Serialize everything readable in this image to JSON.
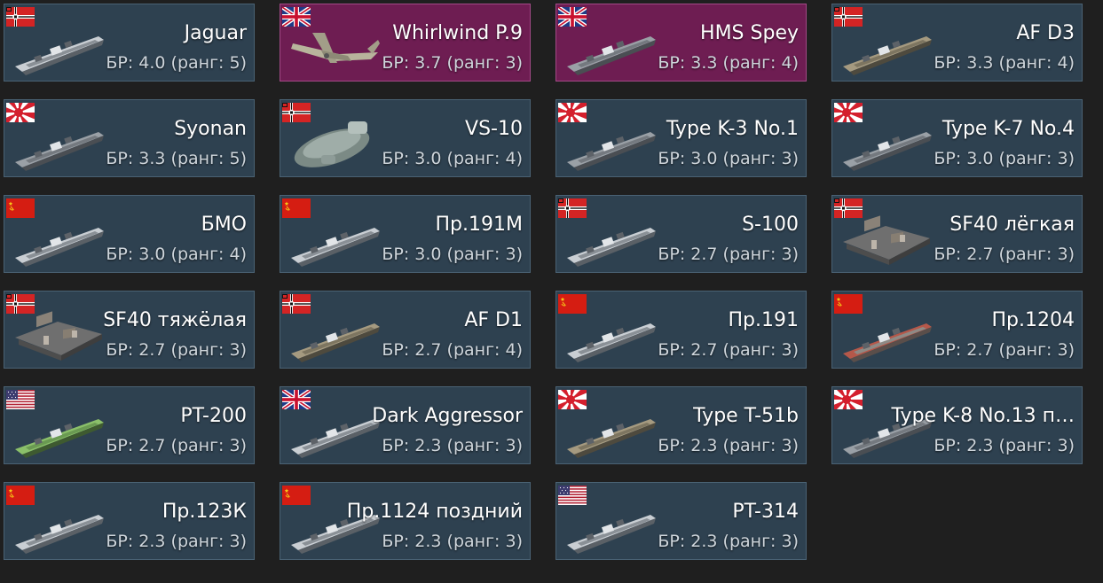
{
  "vehicles": [
    {
      "name": "Jaguar",
      "br": "БР: 4.0 (ранг: 5)",
      "nation": "germany",
      "premium": false,
      "type": "boat"
    },
    {
      "name": "Whirlwind P.9",
      "br": "БР: 3.7 (ранг: 3)",
      "nation": "uk",
      "premium": true,
      "type": "plane"
    },
    {
      "name": "HMS Spey",
      "br": "БР: 3.3 (ранг: 4)",
      "nation": "uk",
      "premium": true,
      "type": "ship"
    },
    {
      "name": "AF D3",
      "br": "БР: 3.3 (ранг: 4)",
      "nation": "germany",
      "premium": false,
      "type": "barge"
    },
    {
      "name": "Syonan",
      "br": "БР: 3.3 (ранг: 5)",
      "nation": "japan",
      "premium": false,
      "type": "ship"
    },
    {
      "name": "VS-10",
      "br": "БР: 3.0 (ранг: 4)",
      "nation": "germany",
      "premium": false,
      "type": "hover"
    },
    {
      "name": "Type K-3 No.1",
      "br": "БР: 3.0 (ранг: 3)",
      "nation": "japan",
      "premium": false,
      "type": "ship"
    },
    {
      "name": "Type K-7 No.4",
      "br": "БР: 3.0 (ранг: 3)",
      "nation": "japan",
      "premium": false,
      "type": "ship"
    },
    {
      "name": "БМО",
      "br": "БР: 3.0 (ранг: 4)",
      "nation": "ussr",
      "premium": false,
      "type": "boat"
    },
    {
      "name": "Пр.191М",
      "br": "БР: 3.0 (ранг: 3)",
      "nation": "ussr",
      "premium": false,
      "type": "boat"
    },
    {
      "name": "S-100",
      "br": "БР: 2.7 (ранг: 3)",
      "nation": "germany",
      "premium": false,
      "type": "boat"
    },
    {
      "name": "SF40 лёгкая",
      "br": "БР: 2.7 (ранг: 3)",
      "nation": "germany",
      "premium": false,
      "type": "ferry"
    },
    {
      "name": "SF40 тяжёлая",
      "br": "БР: 2.7 (ранг: 3)",
      "nation": "germany",
      "premium": false,
      "type": "ferry"
    },
    {
      "name": "AF D1",
      "br": "БР: 2.7 (ранг: 4)",
      "nation": "germany",
      "premium": false,
      "type": "barge"
    },
    {
      "name": "Пр.191",
      "br": "БР: 2.7 (ранг: 3)",
      "nation": "ussr",
      "premium": false,
      "type": "boat"
    },
    {
      "name": "Пр.1204",
      "br": "БР: 2.7 (ранг: 3)",
      "nation": "ussr",
      "premium": false,
      "type": "boat-red"
    },
    {
      "name": "PT-200",
      "br": "БР: 2.7 (ранг: 3)",
      "nation": "usa",
      "premium": false,
      "type": "boat-green"
    },
    {
      "name": "Dark Aggressor",
      "br": "БР: 2.3 (ранг: 3)",
      "nation": "uk",
      "premium": false,
      "type": "boat"
    },
    {
      "name": "Type T-51b",
      "br": "БР: 2.3 (ранг: 3)",
      "nation": "japan",
      "premium": false,
      "type": "barge"
    },
    {
      "name": "Type K-8 No.13 п…",
      "br": "БР: 2.3 (ранг: 3)",
      "nation": "japan",
      "premium": false,
      "type": "ship"
    },
    {
      "name": "Пр.123К",
      "br": "БР: 2.3 (ранг: 3)",
      "nation": "ussr",
      "premium": false,
      "type": "boat"
    },
    {
      "name": "Пр.1124 поздний",
      "br": "БР: 2.3 (ранг: 3)",
      "nation": "ussr",
      "premium": false,
      "type": "boat"
    },
    {
      "name": "PT-314",
      "br": "БР: 2.3 (ранг: 3)",
      "nation": "usa",
      "premium": false,
      "type": "boat"
    }
  ],
  "colors": {
    "card_bg": "#2e4150",
    "card_border": "#4a6274",
    "premium_bg": "#6e1d52",
    "premium_border": "#a24a86",
    "page_bg": "#1f1f1f"
  }
}
